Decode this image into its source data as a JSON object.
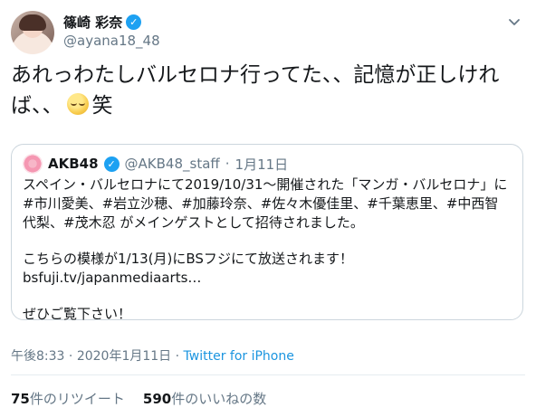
{
  "author": {
    "display_name": "篠崎 彩奈",
    "handle": "@ayana18_48",
    "verified_glyph": "✓",
    "avatar_icon": "profile-photo"
  },
  "tweet": {
    "text_before_emoji": "あれっわたしバルセロナ行ってた、、記憶が正しければ、、",
    "emoji_icon": "face-with-rolling-eyes-emoji",
    "text_after_emoji": "笑"
  },
  "quote": {
    "display_name": "AKB48",
    "verified_glyph": "✓",
    "handle": "@AKB48_staff",
    "separator": "·",
    "date": "1月11日",
    "line1": "スペイン・バルセロナにて2019/10/31〜開催された「マンガ・バルセロナ」に #市川愛美、#岩立沙穂、#加藤玲奈、#佐々木優佳里、#千葉恵里、#中西智代梨、#茂木忍 がメインゲストとして招待されました。",
    "line2": "こちらの模様が1/13(月)にBSフジにて放送されます！",
    "line3": "bsfuji.tv/japanmediaarts…",
    "line4": "ぜひご覧下さい！"
  },
  "meta": {
    "time": "午後8:33",
    "separator1": " · ",
    "date": "2020年1月11日",
    "separator2": " · ",
    "source": "Twitter for iPhone"
  },
  "stats": {
    "retweets_count": "75",
    "retweets_label": "件のリツイート",
    "likes_count": "590",
    "likes_label": "件のいいねの数"
  },
  "colors": {
    "verified_blue": "#1da1f2",
    "link_blue": "#1b95e0",
    "secondary_text": "#657786",
    "border": "#ccd6dd"
  }
}
